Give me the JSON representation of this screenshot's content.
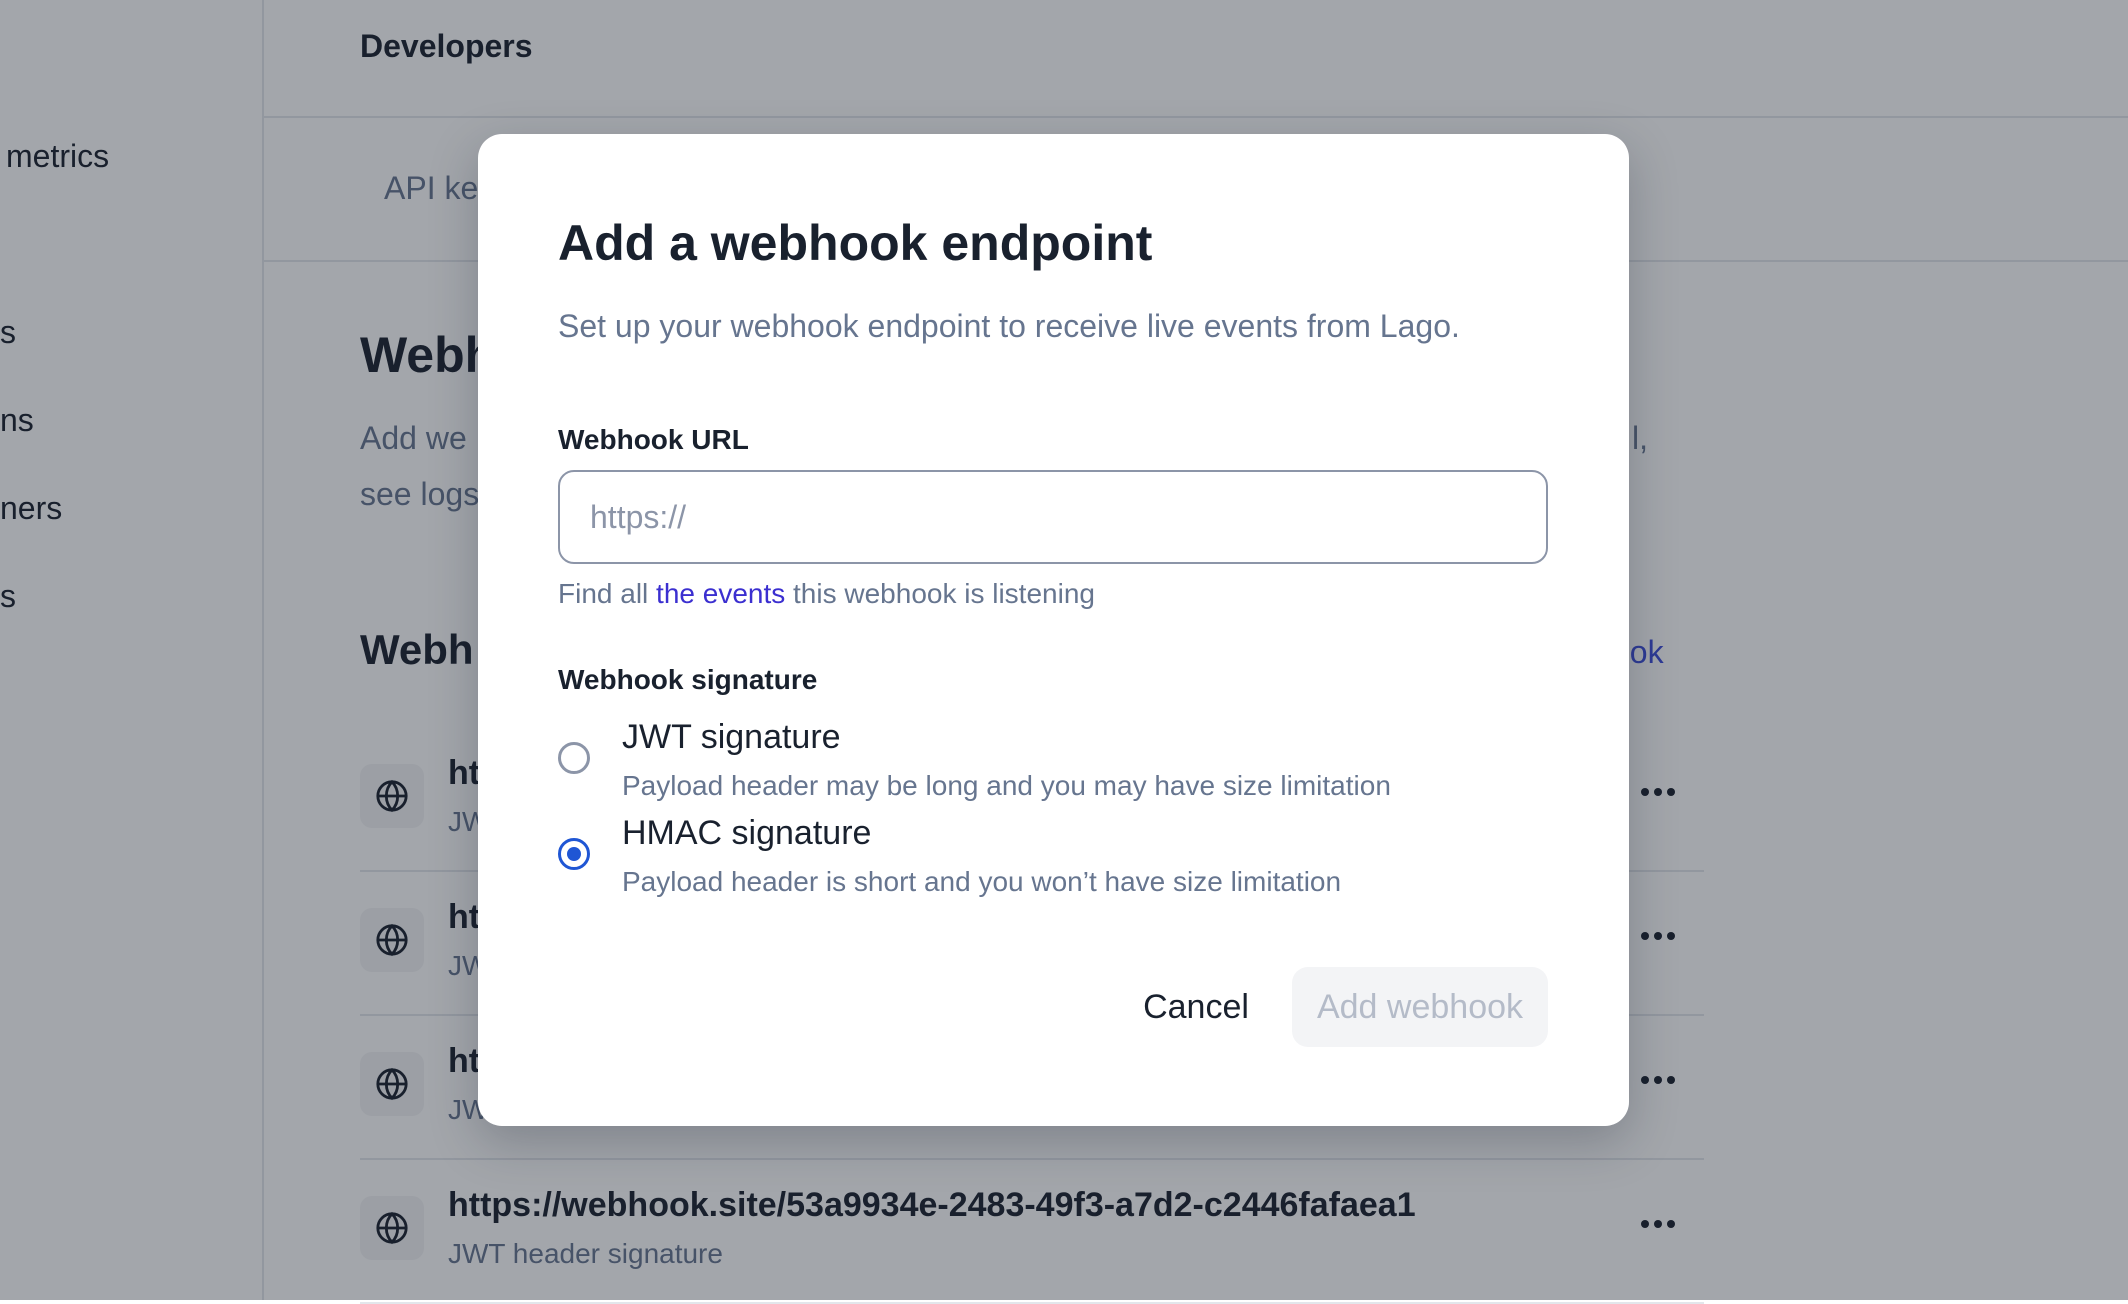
{
  "sidebar": {
    "items": [
      {
        "label": "metrics"
      },
      {
        "label": "s"
      },
      {
        "label": "ns"
      },
      {
        "label": "ners"
      },
      {
        "label": "s"
      }
    ]
  },
  "header": {
    "title": "Developers"
  },
  "tabs": [
    {
      "label": "API ke"
    }
  ],
  "section": {
    "title": "Webh",
    "description_line1": "Add we",
    "description_line1_end": "l,",
    "description_line2": "see logs"
  },
  "webhooks": {
    "title": "Webh",
    "add_action_fragment": "ook",
    "rows": [
      {
        "url": "ht",
        "signature": "JW"
      },
      {
        "url": "ht",
        "signature": "JW"
      },
      {
        "url": "ht",
        "signature": "JW"
      },
      {
        "url": "https://webhook.site/53a9934e-2483-49f3-a7d2-c2446fafaea1",
        "signature": "JWT header signature"
      }
    ]
  },
  "modal": {
    "title": "Add a webhook endpoint",
    "description": "Set up your webhook endpoint to receive live events from Lago.",
    "url_field": {
      "label": "Webhook URL",
      "placeholder": "https://",
      "value": ""
    },
    "helper": {
      "prefix": "Find all ",
      "link_text": "the events",
      "suffix": " this webhook is listening"
    },
    "signature_field": {
      "label": "Webhook signature",
      "options": [
        {
          "title": "JWT signature",
          "description": "Payload header may be long and you may have size limitation",
          "selected": false
        },
        {
          "title": "HMAC signature",
          "description": "Payload header is short and you won’t have size limitation",
          "selected": true
        }
      ]
    },
    "buttons": {
      "cancel": "Cancel",
      "submit": "Add webhook"
    }
  },
  "colors": {
    "accent": "#1f56d4",
    "link": "#3b2fd0",
    "overlay": "rgba(25,33,46,0.4)",
    "muted_text": "#66758f"
  },
  "icons": {
    "row_icon": "globe-icon",
    "row_menu": "more-horizontal-icon"
  }
}
